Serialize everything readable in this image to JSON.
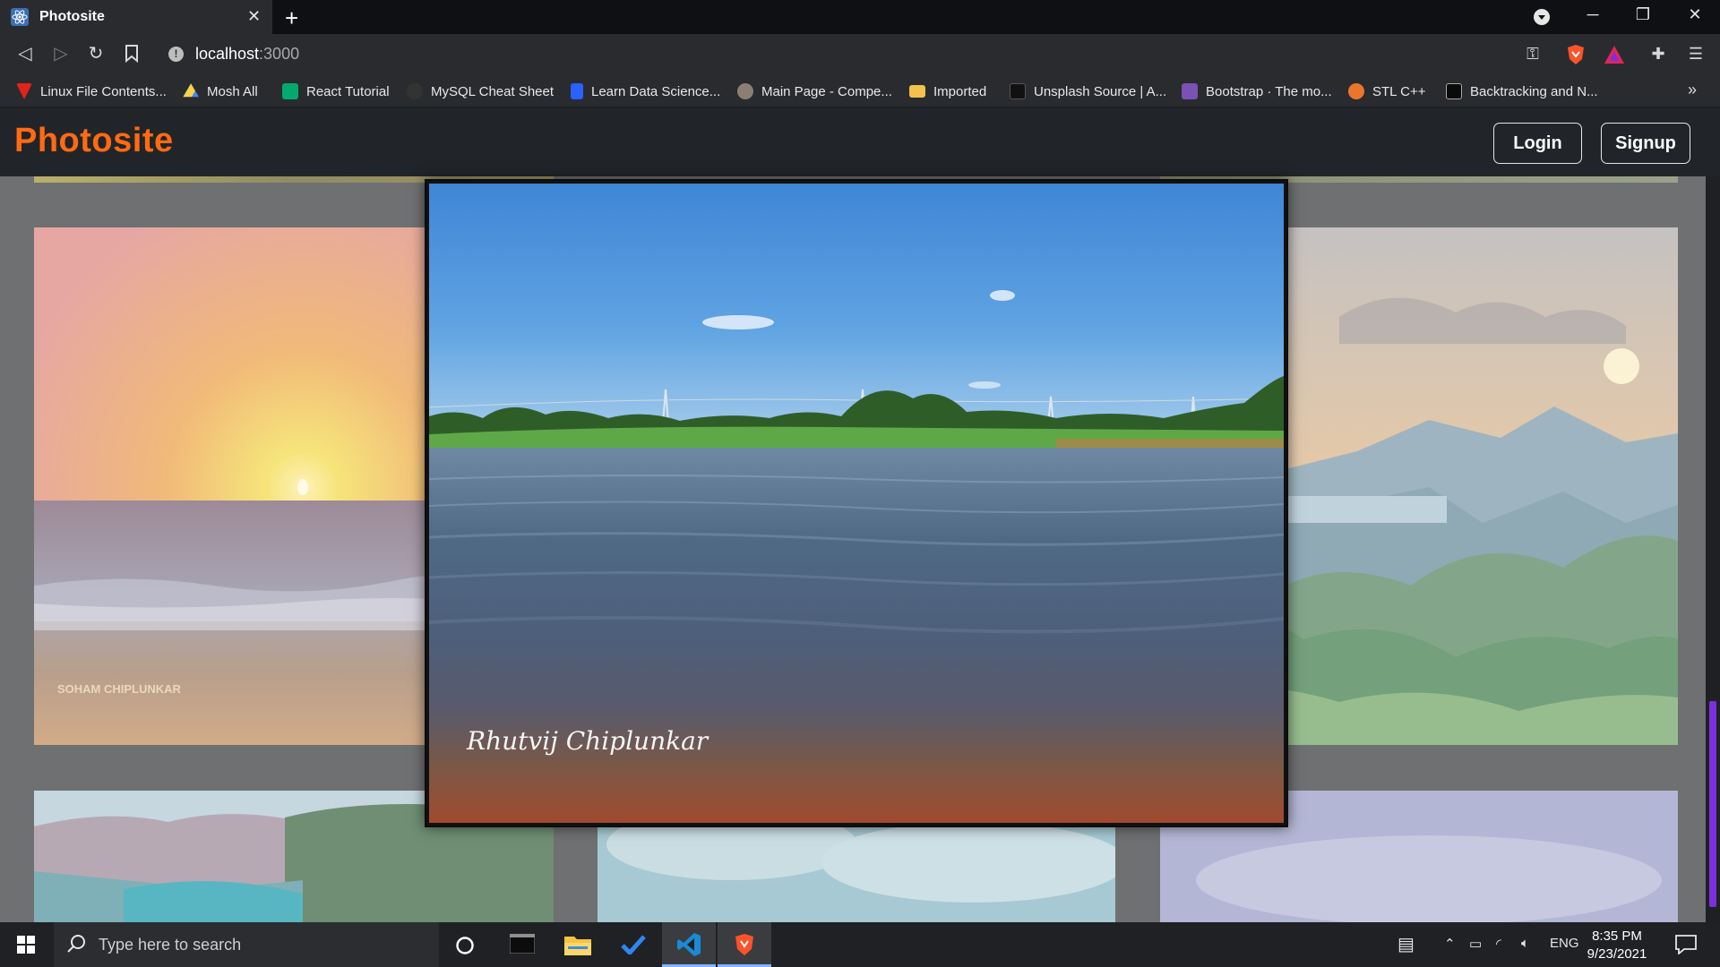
{
  "browser": {
    "tab_title": "Photosite",
    "new_tab_label": "+",
    "url_host": "localhost",
    "url_port": ":3000",
    "bookmarks": [
      {
        "label": "Linux File Contents...",
        "icon": "red-triangle-icon",
        "color": "#e2231a"
      },
      {
        "label": "Mosh All",
        "icon": "google-drive-icon",
        "color": "#1fa463"
      },
      {
        "label": "React Tutorial",
        "icon": "w3-icon",
        "color": "#04aa6d"
      },
      {
        "label": "MySQL Cheat Sheet",
        "icon": "github-icon",
        "color": "#333333"
      },
      {
        "label": "Learn Data Science...",
        "icon": "doc-icon",
        "color": "#2962ff"
      },
      {
        "label": "Main Page - Compe...",
        "icon": "wiki-icon",
        "color": "#8a7f72"
      },
      {
        "label": "Imported",
        "icon": "folder-icon",
        "color": "#f2c14e"
      },
      {
        "label": "Unsplash Source | A...",
        "icon": "unsplash-icon",
        "color": "#111111"
      },
      {
        "label": "Bootstrap · The mo...",
        "icon": "bootstrap-icon",
        "color": "#7952b3"
      },
      {
        "label": "STL C++",
        "icon": "gfg-icon",
        "color": "#e8762c"
      },
      {
        "label": "Backtracking and N...",
        "icon": "play-icon",
        "color": "#0a0a0a"
      }
    ],
    "overflow_label": "»"
  },
  "site": {
    "brand": "Photosite",
    "login_label": "Login",
    "signup_label": "Signup",
    "accent_color": "#ff6a13"
  },
  "gallery": {
    "left_watermark": "SOHAM CHIPLUNKAR"
  },
  "modal": {
    "photo_watermark": "Rhutvij  Chiplunkar"
  },
  "taskbar": {
    "search_placeholder": "Type here to search",
    "language": "ENG",
    "time": "8:35 PM",
    "date": "9/23/2021"
  }
}
